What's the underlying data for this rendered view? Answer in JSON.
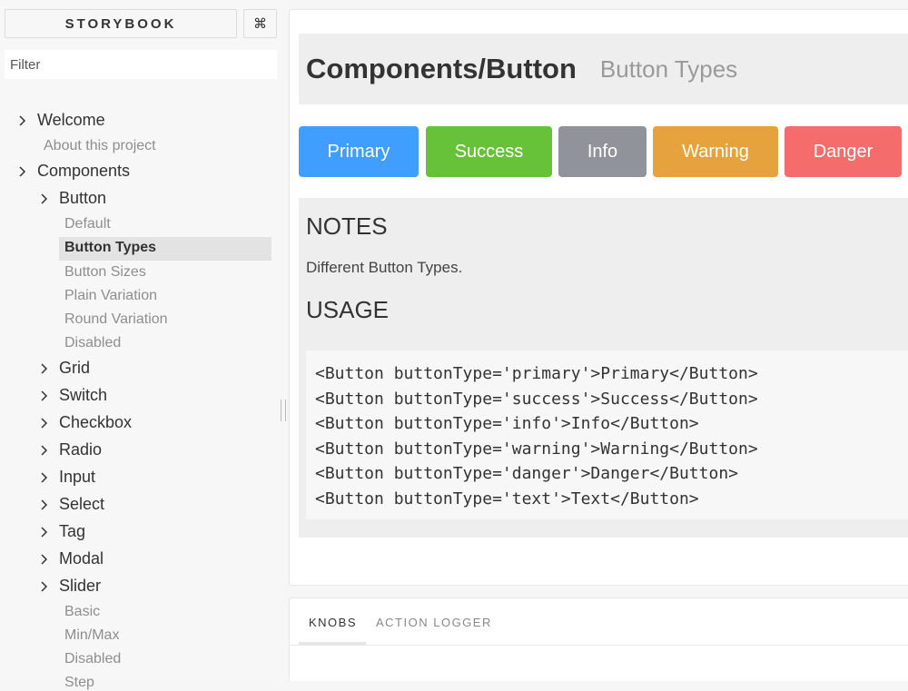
{
  "sidebar": {
    "brand": "STORYBOOK",
    "shortcut_icon": "⌘",
    "filter_placeholder": "Filter",
    "tree": {
      "welcome": "Welcome",
      "about": "About this project",
      "components": "Components",
      "button": "Button",
      "button_stories": [
        "Default",
        "Button Types",
        "Button Sizes",
        "Plain Variation",
        "Round Variation",
        "Disabled"
      ],
      "selected_story": "Button Types",
      "groups": [
        "Grid",
        "Switch",
        "Checkbox",
        "Radio",
        "Input",
        "Select",
        "Tag",
        "Modal",
        "Slider"
      ],
      "slider_stories": [
        "Basic",
        "Min/Max",
        "Disabled",
        "Step"
      ]
    }
  },
  "preview": {
    "kind": "Components/Button",
    "story": "Button Types",
    "buttons": [
      {
        "label": "Primary",
        "color": "#409eff"
      },
      {
        "label": "Success",
        "color": "#67c23a"
      },
      {
        "label": "Info",
        "color": "#909399"
      },
      {
        "label": "Warning",
        "color": "#e6a23c"
      },
      {
        "label": "Danger",
        "color": "#f56c6c"
      }
    ],
    "notes_heading": "NOTES",
    "notes_text": "Different Button Types.",
    "usage_heading": "USAGE",
    "code_lines": [
      "<Button buttonType='primary'>Primary</Button>",
      "<Button buttonType='success'>Success</Button>",
      "<Button buttonType='info'>Info</Button>",
      "<Button buttonType='warning'>Warning</Button>",
      "<Button buttonType='danger'>Danger</Button>",
      "<Button buttonType='text'>Text</Button>"
    ]
  },
  "addons": {
    "tabs": [
      "KNOBS",
      "ACTION LOGGER"
    ],
    "active_tab": "KNOBS"
  }
}
